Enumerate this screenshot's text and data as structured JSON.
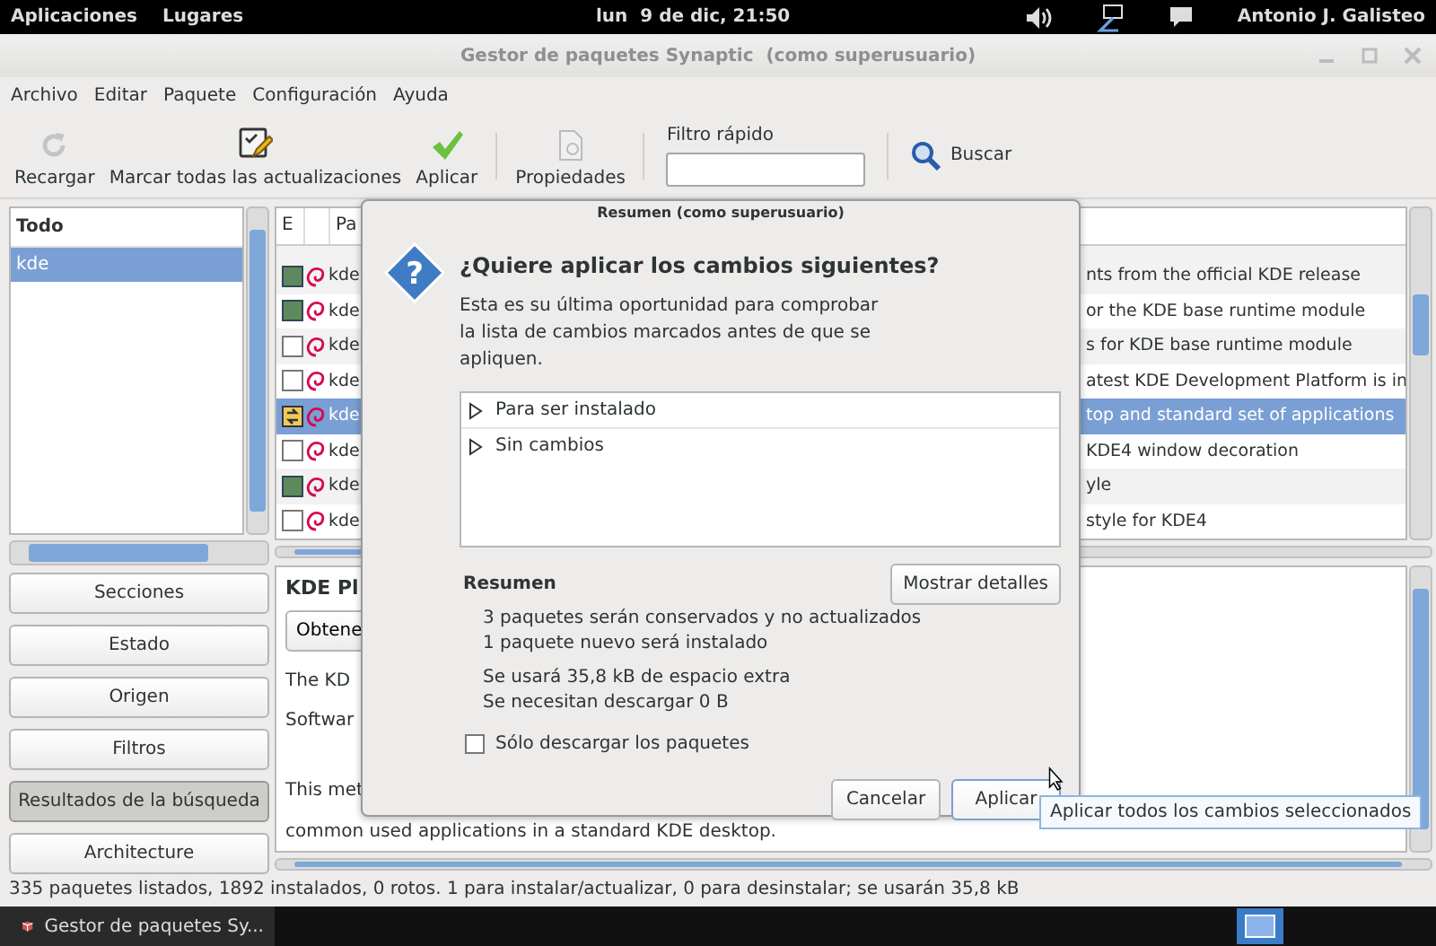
{
  "top_panel": {
    "menus": [
      "Aplicaciones",
      "Lugares"
    ],
    "clock": "lun  9 de dic, 21:50",
    "user": "Antonio J. Galisteo"
  },
  "window": {
    "title": "Gestor de paquetes Synaptic  (como superusuario)"
  },
  "menu_bar": [
    "Archivo",
    "Editar",
    "Paquete",
    "Configuración",
    "Ayuda"
  ],
  "toolbar": {
    "buttons": [
      {
        "label": "Recargar",
        "kind": "reload",
        "disabled": true
      },
      {
        "label": "Marcar todas las actualizaciones",
        "kind": "mark",
        "disabled": false
      },
      {
        "label": "Aplicar",
        "kind": "apply",
        "disabled": false
      },
      {
        "label": "Propiedades",
        "kind": "properties",
        "disabled": true
      }
    ],
    "filter_label": "Filtro rápido",
    "search_label": "Buscar"
  },
  "filter_list": {
    "header": "Todo",
    "items": [
      {
        "label": "kde",
        "selected": true
      }
    ]
  },
  "filter_buttons": [
    {
      "label": "Secciones",
      "selected": false
    },
    {
      "label": "Estado",
      "selected": false
    },
    {
      "label": "Origen",
      "selected": false
    },
    {
      "label": "Filtros",
      "selected": false
    },
    {
      "label": "Resultados de la búsqueda",
      "selected": true
    },
    {
      "label": "Architecture",
      "selected": false
    }
  ],
  "package_table": {
    "columns": [
      "E",
      "Pa"
    ],
    "rows": [
      {
        "installed": true,
        "marked_for_upgrade": false,
        "name": "kde",
        "description": "nts from the official KDE release",
        "selected": false
      },
      {
        "installed": true,
        "marked_for_upgrade": false,
        "name": "kde",
        "description": "or the KDE base runtime module",
        "selected": false
      },
      {
        "installed": false,
        "marked_for_upgrade": false,
        "name": "kde",
        "description": "s for KDE base runtime module",
        "selected": false
      },
      {
        "installed": false,
        "marked_for_upgrade": false,
        "name": "kde",
        "description": "atest KDE Development Platform is in",
        "selected": false
      },
      {
        "installed": true,
        "marked_for_upgrade": true,
        "name": "kde",
        "description": "top and standard set of applications",
        "selected": true
      },
      {
        "installed": false,
        "marked_for_upgrade": false,
        "name": "kde",
        "description": "KDE4 window decoration",
        "selected": false
      },
      {
        "installed": true,
        "marked_for_upgrade": false,
        "name": "kde",
        "description": "yle",
        "selected": false
      },
      {
        "installed": false,
        "marked_for_upgrade": false,
        "name": "kde",
        "description": "style for KDE4",
        "selected": false
      }
    ]
  },
  "details": {
    "title": "KDE Pl",
    "button": "Obtene",
    "lines": [
      "The KD",
      "Softwar",
      "This met"
    ],
    "last_line": "common used applications in a standard KDE desktop."
  },
  "dialog": {
    "title": "Resumen (como superusuario)",
    "icon_glyph": "?",
    "heading": "¿Quiere aplicar los cambios siguientes?",
    "message": "Esta es su última oportunidad para comprobar la lista de cambios marcados antes de que se apliquen.",
    "tree": [
      {
        "label": "Para ser instalado",
        "expanded": false
      },
      {
        "label": "Sin cambios",
        "expanded": false
      }
    ],
    "summary_title": "Resumen",
    "details_button": "Mostrar detalles",
    "summary_lines": [
      "3 paquetes serán conservados y no actualizados",
      "1 paquete nuevo será instalado"
    ],
    "size_lines": [
      "Se usará 35,8 kB de espacio extra",
      "Se necesitan descargar 0  B"
    ],
    "download_only": {
      "label": "Sólo descargar los paquetes",
      "checked": false
    },
    "buttons": [
      {
        "label": "Cancelar",
        "focused": false
      },
      {
        "label": "Aplicar",
        "focused": true
      }
    ]
  },
  "tooltip": "Aplicar todos los cambios seleccionados",
  "status_bar": "335 paquetes listados, 1892 instalados, 0 rotos. 1 para instalar/actualizar, 0 para desinstalar; se usarán 35,8 kB",
  "taskbar": {
    "task": "Gestor de paquetes Sy..."
  }
}
